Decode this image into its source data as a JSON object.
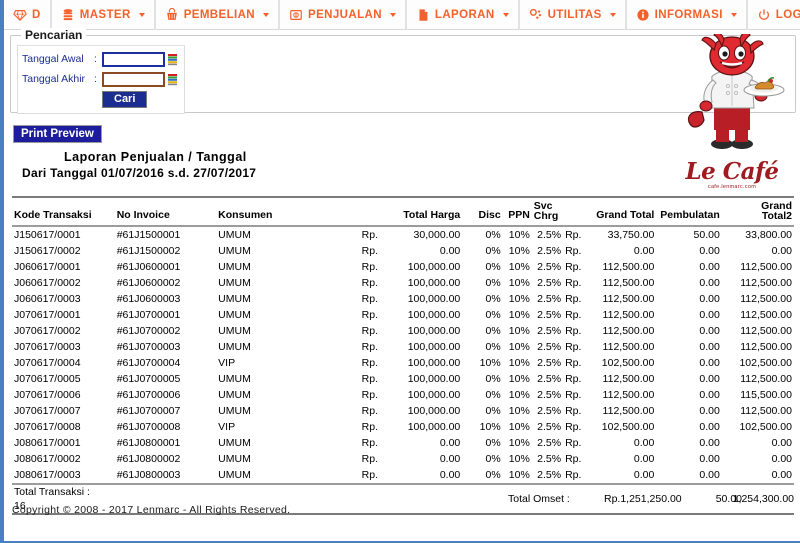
{
  "menubar": {
    "items": [
      {
        "label": "D",
        "icon": "diamond-icon",
        "has_caret": false
      },
      {
        "label": "MASTER",
        "icon": "database-icon",
        "has_caret": true
      },
      {
        "label": "PEMBELIAN",
        "icon": "basket-icon",
        "has_caret": true
      },
      {
        "label": "PENJUALAN",
        "icon": "cash-register-icon",
        "has_caret": true
      },
      {
        "label": "LAPORAN",
        "icon": "document-icon",
        "has_caret": true
      },
      {
        "label": "UTILITAS",
        "icon": "settings-icon",
        "has_caret": true
      },
      {
        "label": "INFORMASI",
        "icon": "info-icon",
        "has_caret": true
      },
      {
        "label": "LOG  OUT",
        "icon": "power-icon",
        "has_caret": false
      }
    ],
    "accent_color": "#f4602c"
  },
  "search": {
    "legend": "Pencarian",
    "field_awal_label": "Tanggal   Awal",
    "field_akhir_label": "Tanggal   Akhir",
    "colon": ":",
    "awal_value": "",
    "akhir_value": "",
    "awal_placeholder": "",
    "akhir_placeholder": "",
    "submit_label": "Cari",
    "submit_color": "#1c2d91",
    "label_color": "#1c2d91"
  },
  "print_preview": {
    "label": "Print Preview",
    "color": "#1c1c9c"
  },
  "report": {
    "title": "Laporan   Penjualan   /   Tanggal",
    "range": "Dari  Tanggal   01/07/2016  s.d.   27/07/2017",
    "headers": {
      "kode": "Kode  Transaksi",
      "invoice": "No  Invoice",
      "konsumen": "Konsumen",
      "total_harga": "Total   Harga",
      "disc": "Disc",
      "ppn": "PPN",
      "svc_chrg_line1": "Svc",
      "svc_chrg_line2": "Chrg",
      "grand_total": "Grand   Total",
      "pembulatan": "Pembulatan",
      "grand_total2_line1": "Grand",
      "grand_total2_line2": "Total2"
    },
    "rows": [
      {
        "kode": "J150617/0001",
        "invoice": "#61J1500001",
        "konsumen": "UMUM",
        "rp": "Rp.",
        "total_harga": "30,000.00",
        "disc": "0%",
        "ppn": "10%",
        "svc": "2.5%",
        "grand_rp": "Rp.",
        "grand_total": "33,750.00",
        "pembulatan": "50.00",
        "grand_total2": "33,800.00"
      },
      {
        "kode": "J150617/0002",
        "invoice": "#61J1500002",
        "konsumen": "UMUM",
        "rp": "Rp.",
        "total_harga": "0.00",
        "disc": "0%",
        "ppn": "10%",
        "svc": "2.5%",
        "grand_rp": "Rp.",
        "grand_total": "0.00",
        "pembulatan": "0.00",
        "grand_total2": "0.00"
      },
      {
        "kode": "J060617/0001",
        "invoice": "#61J0600001",
        "konsumen": "UMUM",
        "rp": "Rp.",
        "total_harga": "100,000.00",
        "disc": "0%",
        "ppn": "10%",
        "svc": "2.5%",
        "grand_rp": "Rp.",
        "grand_total": "112,500.00",
        "pembulatan": "0.00",
        "grand_total2": "112,500.00"
      },
      {
        "kode": "J060617/0002",
        "invoice": "#61J0600002",
        "konsumen": "UMUM",
        "rp": "Rp.",
        "total_harga": "100,000.00",
        "disc": "0%",
        "ppn": "10%",
        "svc": "2.5%",
        "grand_rp": "Rp.",
        "grand_total": "112,500.00",
        "pembulatan": "0.00",
        "grand_total2": "112,500.00"
      },
      {
        "kode": "J060617/0003",
        "invoice": "#61J0600003",
        "konsumen": "UMUM",
        "rp": "Rp.",
        "total_harga": "100,000.00",
        "disc": "0%",
        "ppn": "10%",
        "svc": "2.5%",
        "grand_rp": "Rp.",
        "grand_total": "112,500.00",
        "pembulatan": "0.00",
        "grand_total2": "112,500.00"
      },
      {
        "kode": "J070617/0001",
        "invoice": "#61J0700001",
        "konsumen": "UMUM",
        "rp": "Rp.",
        "total_harga": "100,000.00",
        "disc": "0%",
        "ppn": "10%",
        "svc": "2.5%",
        "grand_rp": "Rp.",
        "grand_total": "112,500.00",
        "pembulatan": "0.00",
        "grand_total2": "112,500.00"
      },
      {
        "kode": "J070617/0002",
        "invoice": "#61J0700002",
        "konsumen": "UMUM",
        "rp": "Rp.",
        "total_harga": "100,000.00",
        "disc": "0%",
        "ppn": "10%",
        "svc": "2.5%",
        "grand_rp": "Rp.",
        "grand_total": "112,500.00",
        "pembulatan": "0.00",
        "grand_total2": "112,500.00"
      },
      {
        "kode": "J070617/0003",
        "invoice": "#61J0700003",
        "konsumen": "UMUM",
        "rp": "Rp.",
        "total_harga": "100,000.00",
        "disc": "0%",
        "ppn": "10%",
        "svc": "2.5%",
        "grand_rp": "Rp.",
        "grand_total": "112,500.00",
        "pembulatan": "0.00",
        "grand_total2": "112,500.00"
      },
      {
        "kode": "J070617/0004",
        "invoice": "#61J0700004",
        "konsumen": "VIP",
        "rp": "Rp.",
        "total_harga": "100,000.00",
        "disc": "10%",
        "ppn": "10%",
        "svc": "2.5%",
        "grand_rp": "Rp.",
        "grand_total": "102,500.00",
        "pembulatan": "0.00",
        "grand_total2": "102,500.00"
      },
      {
        "kode": "J070617/0005",
        "invoice": "#61J0700005",
        "konsumen": "UMUM",
        "rp": "Rp.",
        "total_harga": "100,000.00",
        "disc": "0%",
        "ppn": "10%",
        "svc": "2.5%",
        "grand_rp": "Rp.",
        "grand_total": "112,500.00",
        "pembulatan": "0.00",
        "grand_total2": "112,500.00"
      },
      {
        "kode": "J070617/0006",
        "invoice": "#61J0700006",
        "konsumen": "UMUM",
        "rp": "Rp.",
        "total_harga": "100,000.00",
        "disc": "0%",
        "ppn": "10%",
        "svc": "2.5%",
        "grand_rp": "Rp.",
        "grand_total": "112,500.00",
        "pembulatan": "0.00",
        "grand_total2": "115,500.00"
      },
      {
        "kode": "J070617/0007",
        "invoice": "#61J0700007",
        "konsumen": "UMUM",
        "rp": "Rp.",
        "total_harga": "100,000.00",
        "disc": "0%",
        "ppn": "10%",
        "svc": "2.5%",
        "grand_rp": "Rp.",
        "grand_total": "112,500.00",
        "pembulatan": "0.00",
        "grand_total2": "112,500.00"
      },
      {
        "kode": "J070617/0008",
        "invoice": "#61J0700008",
        "konsumen": "VIP",
        "rp": "Rp.",
        "total_harga": "100,000.00",
        "disc": "10%",
        "ppn": "10%",
        "svc": "2.5%",
        "grand_rp": "Rp.",
        "grand_total": "102,500.00",
        "pembulatan": "0.00",
        "grand_total2": "102,500.00"
      },
      {
        "kode": "J080617/0001",
        "invoice": "#61J0800001",
        "konsumen": "UMUM",
        "rp": "Rp.",
        "total_harga": "0.00",
        "disc": "0%",
        "ppn": "10%",
        "svc": "2.5%",
        "grand_rp": "Rp.",
        "grand_total": "0.00",
        "pembulatan": "0.00",
        "grand_total2": "0.00"
      },
      {
        "kode": "J080617/0002",
        "invoice": "#61J0800002",
        "konsumen": "UMUM",
        "rp": "Rp.",
        "total_harga": "0.00",
        "disc": "0%",
        "ppn": "10%",
        "svc": "2.5%",
        "grand_rp": "Rp.",
        "grand_total": "0.00",
        "pembulatan": "0.00",
        "grand_total2": "0.00"
      },
      {
        "kode": "J080617/0003",
        "invoice": "#61J0800003",
        "konsumen": "UMUM",
        "rp": "Rp.",
        "total_harga": "0.00",
        "disc": "0%",
        "ppn": "10%",
        "svc": "2.5%",
        "grand_rp": "Rp.",
        "grand_total": "0.00",
        "pembulatan": "0.00",
        "grand_total2": "0.00"
      }
    ],
    "totals": {
      "transaksi_label": "Total   Transaksi    :",
      "transaksi_count": "16",
      "omset_label": "Total   Omset   :",
      "omset_value": "Rp.1,251,250.00",
      "pembulatan": "50.00",
      "grand_total2": "1,254,300.00"
    }
  },
  "logo": {
    "name": "Le Café",
    "subtitle": "cafe.lenmarc.com",
    "mascot": "red-dragon-chef-mascot",
    "color": "#9e1b20"
  },
  "footer": {
    "copyright": "Copyright  ©  2008  -  2017  Lenmarc  -  All  Rights  Reserved."
  }
}
